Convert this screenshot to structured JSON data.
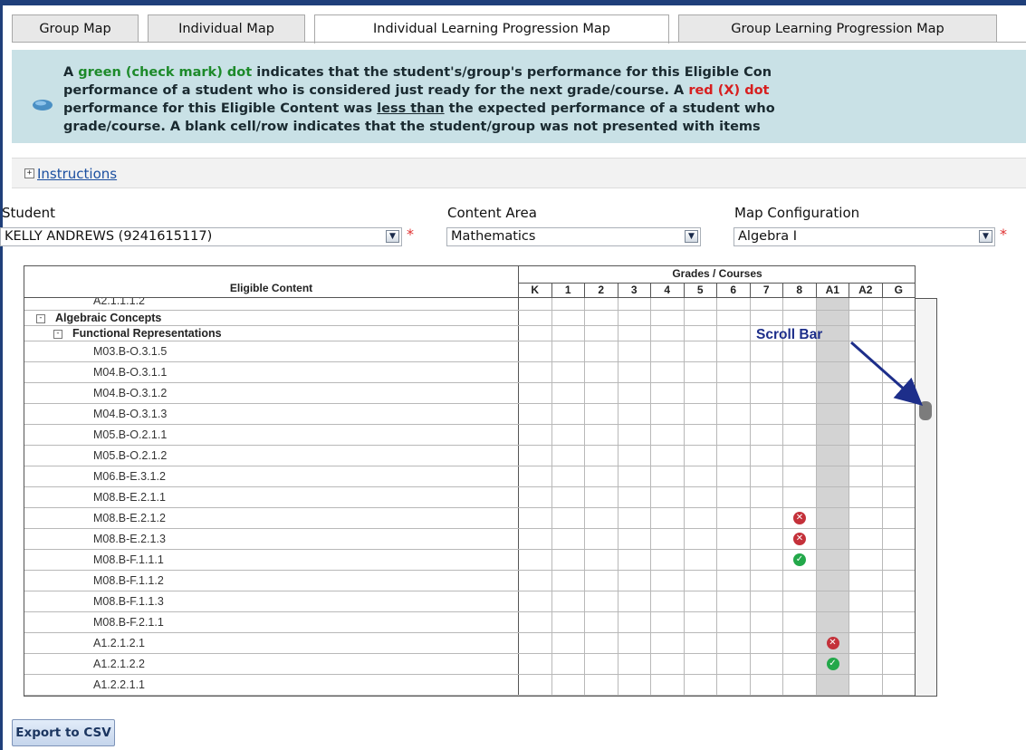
{
  "tabs": [
    {
      "label": "Group Map",
      "active": false
    },
    {
      "label": "Individual Map",
      "active": false
    },
    {
      "label": "Individual Learning Progression Map",
      "active": true
    },
    {
      "label": "Group Learning Progression Map",
      "active": false
    }
  ],
  "info": {
    "l1a": "A ",
    "l1b": "green (check mark) dot",
    "l1c": " indicates that the student's/group's performance for this Eligible Con",
    "l2a": "performance of a student who is considered just ready for the next grade/course. A ",
    "l2b": "red (X) dot",
    "l3a": "performance for this Eligible Content was ",
    "l3b": "less than",
    "l3c": " the expected performance of a student who",
    "l4": "grade/course. A blank cell/row indicates that the student/group was not presented with items"
  },
  "instructions": {
    "label": "Instructions"
  },
  "filters": {
    "student": {
      "label": "Student",
      "value": "KELLY ANDREWS (9241615117)"
    },
    "content_area": {
      "label": "Content Area",
      "value": "Mathematics"
    },
    "map_configuration": {
      "label": "Map Configuration",
      "value": "Algebra I"
    },
    "required_mark": "*"
  },
  "grid": {
    "eligible_content_header": "Eligible Content",
    "grades_header": "Grades / Courses",
    "grades": [
      "K",
      "1",
      "2",
      "3",
      "4",
      "5",
      "6",
      "7",
      "8",
      "A1",
      "A2",
      "G"
    ],
    "partial_row": "A2.1.1.1.2",
    "section": "Algebraic Concepts",
    "subsection": "Functional Representations",
    "rows": [
      {
        "code": "M03.B-O.3.1.5",
        "mark": null,
        "col": null
      },
      {
        "code": "M04.B-O.3.1.1",
        "mark": null,
        "col": null
      },
      {
        "code": "M04.B-O.3.1.2",
        "mark": null,
        "col": null
      },
      {
        "code": "M04.B-O.3.1.3",
        "mark": null,
        "col": null
      },
      {
        "code": "M05.B-O.2.1.1",
        "mark": null,
        "col": null
      },
      {
        "code": "M05.B-O.2.1.2",
        "mark": null,
        "col": null
      },
      {
        "code": "M06.B-E.3.1.2",
        "mark": null,
        "col": null
      },
      {
        "code": "M08.B-E.2.1.1",
        "mark": null,
        "col": null
      },
      {
        "code": "M08.B-E.2.1.2",
        "mark": "red-x",
        "col": "8"
      },
      {
        "code": "M08.B-E.2.1.3",
        "mark": "red-x",
        "col": "8"
      },
      {
        "code": "M08.B-F.1.1.1",
        "mark": "green-check",
        "col": "8"
      },
      {
        "code": "M08.B-F.1.1.2",
        "mark": null,
        "col": null
      },
      {
        "code": "M08.B-F.1.1.3",
        "mark": null,
        "col": null
      },
      {
        "code": "M08.B-F.2.1.1",
        "mark": null,
        "col": null
      },
      {
        "code": "A1.2.1.2.1",
        "mark": "red-x",
        "col": "A1"
      },
      {
        "code": "A1.2.1.2.2",
        "mark": "green-check",
        "col": "A1"
      },
      {
        "code": "A1.2.2.1.1",
        "mark": null,
        "col": null
      }
    ]
  },
  "annotation": {
    "label": "Scroll Bar"
  },
  "export": {
    "label": "Export to CSV"
  },
  "colors": {
    "accent": "#1f3f7a",
    "green": "#23a84a",
    "red": "#c4313a",
    "info_bg": "#c9e1e6"
  }
}
